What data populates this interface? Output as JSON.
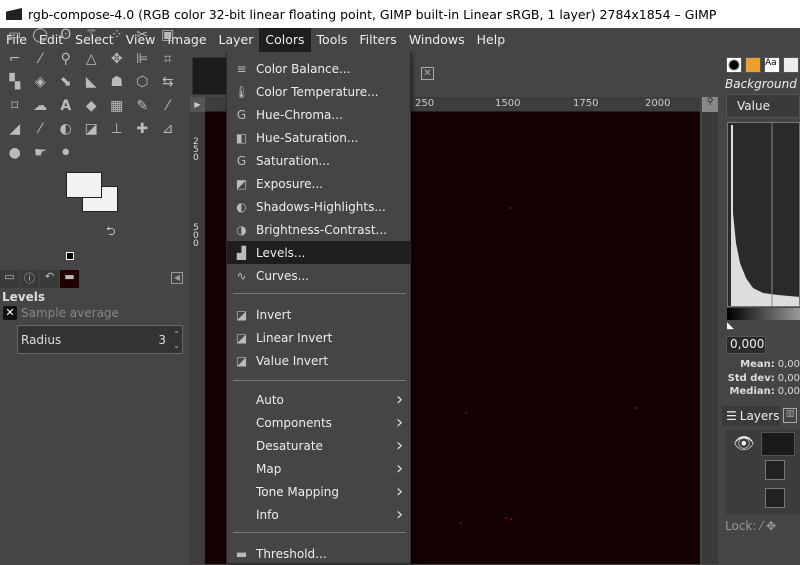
{
  "window": {
    "title": "rgb-compose-4.0 (RGB color 32-bit linear floating point, GIMP built-in Linear sRGB, 1 layer) 2784x1854 – GIMP"
  },
  "menubar": [
    "File",
    "Edit",
    "Select",
    "View",
    "Image",
    "Layer",
    "Colors",
    "Tools",
    "Filters",
    "Windows",
    "Help"
  ],
  "active_menu": "Colors",
  "colors_menu": [
    {
      "label": "Color Balance...",
      "icon": "color-balance-icon"
    },
    {
      "label": "Color Temperature...",
      "icon": "thermometer-icon"
    },
    {
      "label": "Hue-Chroma...",
      "icon": "gegl-icon"
    },
    {
      "label": "Hue-Saturation...",
      "icon": "hue-saturation-icon"
    },
    {
      "label": "Saturation...",
      "icon": "gegl-icon"
    },
    {
      "label": "Exposure...",
      "icon": "exposure-icon"
    },
    {
      "label": "Shadows-Highlights...",
      "icon": "shadows-highlights-icon"
    },
    {
      "label": "Brightness-Contrast...",
      "icon": "brightness-contrast-icon"
    },
    {
      "label": "Levels...",
      "icon": "levels-icon",
      "highlighted": true
    },
    {
      "label": "Curves...",
      "icon": "curves-icon"
    },
    {
      "label": "Invert",
      "icon": "invert-icon"
    },
    {
      "label": "Linear Invert",
      "icon": "invert-icon"
    },
    {
      "label": "Value Invert",
      "icon": "invert-icon"
    },
    {
      "label": "Auto",
      "submenu": true
    },
    {
      "label": "Components",
      "submenu": true
    },
    {
      "label": "Desaturate",
      "submenu": true
    },
    {
      "label": "Map",
      "submenu": true
    },
    {
      "label": "Tone Mapping",
      "submenu": true
    },
    {
      "label": "Info",
      "submenu": true
    },
    {
      "label": "Threshold...",
      "icon": "threshold-icon"
    }
  ],
  "tool_options": {
    "title": "Levels",
    "sample_average": "Sample average",
    "radius_label": "Radius",
    "radius_value": "3"
  },
  "ruler": {
    "h_ticks": [
      "250",
      "1500",
      "1750",
      "2000"
    ],
    "v_ticks": [
      "250",
      "500"
    ]
  },
  "colors": {
    "canvas": "#140000",
    "menu_bg": "#454545",
    "highlight": "#1e1e1e"
  },
  "histogram": {
    "channel_label": "Background",
    "channel": "Value",
    "input_value": "0,000",
    "mean_label": "Mean:",
    "mean": "0,00",
    "std_label": "Std dev:",
    "std": "0,00",
    "median_label": "Median:",
    "median": "0,00"
  },
  "layers": {
    "tab_label": "Layers",
    "lock_label": "Lock:"
  }
}
